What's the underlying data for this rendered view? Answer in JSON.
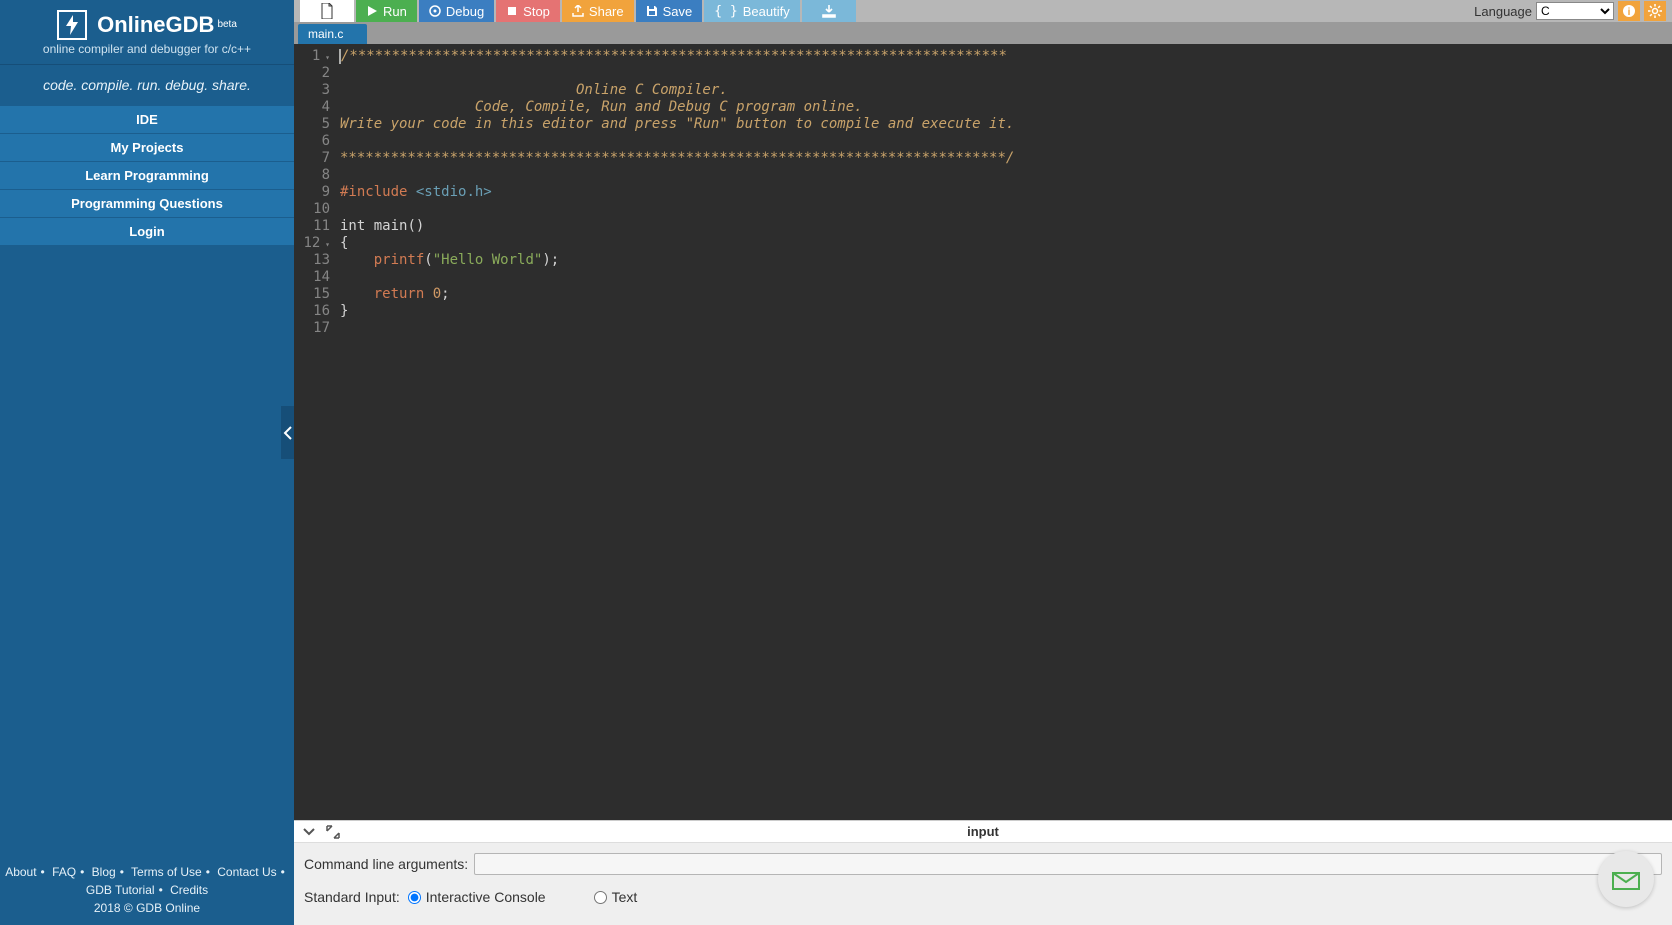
{
  "sidebar": {
    "brand": "OnlineGDB",
    "beta": "beta",
    "subtitle": "online compiler and debugger for c/c++",
    "tagline": "code. compile. run. debug. share.",
    "nav": [
      "IDE",
      "My Projects",
      "Learn Programming",
      "Programming Questions",
      "Login"
    ],
    "footer_links": [
      "About",
      "FAQ",
      "Blog",
      "Terms of Use",
      "Contact Us",
      "GDB Tutorial",
      "Credits"
    ],
    "copyright": "2018 © GDB Online"
  },
  "toolbar": {
    "run": "Run",
    "debug": "Debug",
    "stop": "Stop",
    "share": "Share",
    "save": "Save",
    "beautify": "Beautify",
    "language_label": "Language",
    "language_value": "C"
  },
  "tab": {
    "name": "main.c"
  },
  "code": {
    "lines": [
      {
        "n": 1,
        "fold": true,
        "html": "<span class='c-comment'>/******************************************************************************</span>"
      },
      {
        "n": 2,
        "html": ""
      },
      {
        "n": 3,
        "html": "<span class='c-comment'>                            Online C Compiler.</span>"
      },
      {
        "n": 4,
        "html": "<span class='c-comment'>                Code, Compile, Run and Debug C program online.</span>"
      },
      {
        "n": 5,
        "html": "<span class='c-comment'>Write your code in this editor and press \"Run\" button to compile and execute it.</span>"
      },
      {
        "n": 6,
        "html": ""
      },
      {
        "n": 7,
        "html": "<span class='c-comment'>*******************************************************************************/</span>"
      },
      {
        "n": 8,
        "html": ""
      },
      {
        "n": 9,
        "html": "<span class='c-keyword'>#include</span> <span class='c-include'>&lt;stdio.h&gt;</span>"
      },
      {
        "n": 10,
        "html": ""
      },
      {
        "n": 11,
        "html": "<span class='c-type'>int</span> <span class='c-type'>main</span>()"
      },
      {
        "n": 12,
        "fold": true,
        "html": "{"
      },
      {
        "n": 13,
        "html": "    <span class='c-func'>printf</span>(<span class='c-string'>\"Hello World\"</span>);"
      },
      {
        "n": 14,
        "html": ""
      },
      {
        "n": 15,
        "html": "    <span class='c-keyword'>return</span> <span class='c-num'>0</span>;"
      },
      {
        "n": 16,
        "html": "}"
      },
      {
        "n": 17,
        "html": ""
      }
    ]
  },
  "bottom": {
    "title": "input",
    "cmdline_label": "Command line arguments:",
    "cmdline_value": "",
    "stdin_label": "Standard Input:",
    "radio1": "Interactive Console",
    "radio2": "Text"
  }
}
